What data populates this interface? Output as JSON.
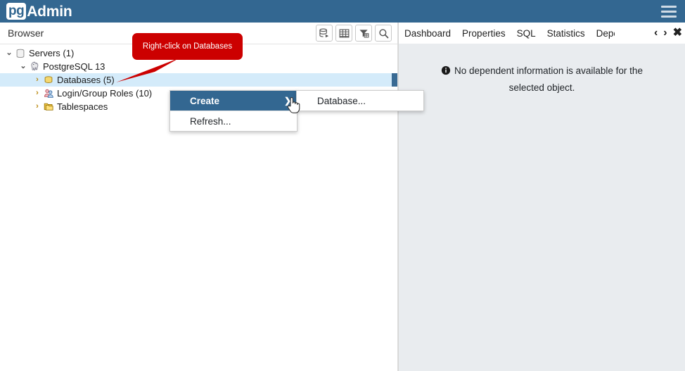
{
  "app": {
    "brand_pg": "pg",
    "brand_admin": "Admin",
    "header_color": "#336791",
    "menu_icon": "hamburger-menu-icon"
  },
  "browser": {
    "title": "Browser",
    "tools": [
      {
        "name": "query-tool-icon",
        "label": "Query Tool"
      },
      {
        "name": "view-data-grid-icon",
        "label": "View Data"
      },
      {
        "name": "filter-icon",
        "label": "Filter"
      },
      {
        "name": "search-icon",
        "label": "Search"
      }
    ],
    "tree": [
      {
        "label": "Servers (1)",
        "twisty": "⌄",
        "state": "open",
        "indent": 6,
        "icon": "server-group-icon",
        "selected": false
      },
      {
        "label": "PostgreSQL 13",
        "twisty": "⌄",
        "state": "open",
        "indent": 26,
        "icon": "postgresql-elephant-icon",
        "selected": false
      },
      {
        "label": "Databases (5)",
        "twisty": "›",
        "state": "closed",
        "indent": 46,
        "icon": "database-icon",
        "selected": true
      },
      {
        "label": "Login/Group Roles (10)",
        "twisty": "›",
        "state": "closed",
        "indent": 46,
        "icon": "roles-icon",
        "selected": false
      },
      {
        "label": "Tablespaces",
        "twisty": "›",
        "state": "closed",
        "indent": 46,
        "icon": "tablespaces-folder-icon",
        "selected": false
      }
    ]
  },
  "callout": {
    "text": "Right-click on Databases",
    "color": "#cc0000"
  },
  "context_menu": {
    "items": [
      {
        "label": "Create",
        "active": true,
        "has_submenu": true,
        "arrow": "❯"
      },
      {
        "label": "Refresh...",
        "active": false,
        "has_submenu": false,
        "arrow": ""
      }
    ],
    "submenu": [
      {
        "label": "Database...",
        "active": false
      }
    ],
    "active_color": "#336791"
  },
  "right_panel": {
    "tabs": [
      {
        "label": "Dashboard",
        "active": false
      },
      {
        "label": "Properties",
        "active": false
      },
      {
        "label": "SQL",
        "active": false
      },
      {
        "label": "Statistics",
        "active": false
      },
      {
        "label": "Dependencies",
        "active": false,
        "clipped": true
      }
    ],
    "nav": {
      "prev": "‹",
      "next": "›",
      "close": "✖"
    },
    "message_line1": "No dependent information is available for the",
    "message_line2": "selected object.",
    "info_icon": "info-circle-icon"
  },
  "selection_highlight_color": "#d4ebfa"
}
